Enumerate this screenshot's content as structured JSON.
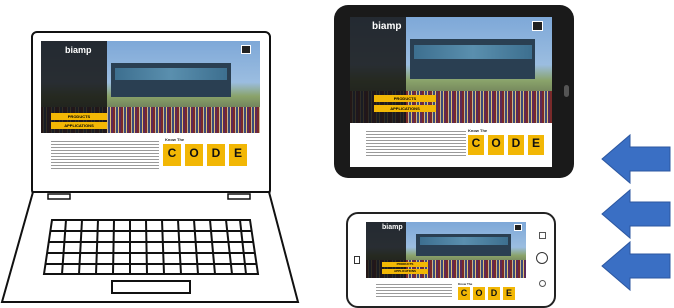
{
  "brand": "biamp",
  "buttons": {
    "products": "PRODUCTS",
    "applications": "APPLICATIONS"
  },
  "know_heading": "Know The",
  "code_letters": [
    "C",
    "O",
    "D",
    "E"
  ],
  "colors": {
    "accent": "#f2b705",
    "arrow": "#3a6fc4",
    "device_frame": "#1a1a1a"
  },
  "icons": [
    "menu-icon",
    "arrow-left-icon"
  ]
}
